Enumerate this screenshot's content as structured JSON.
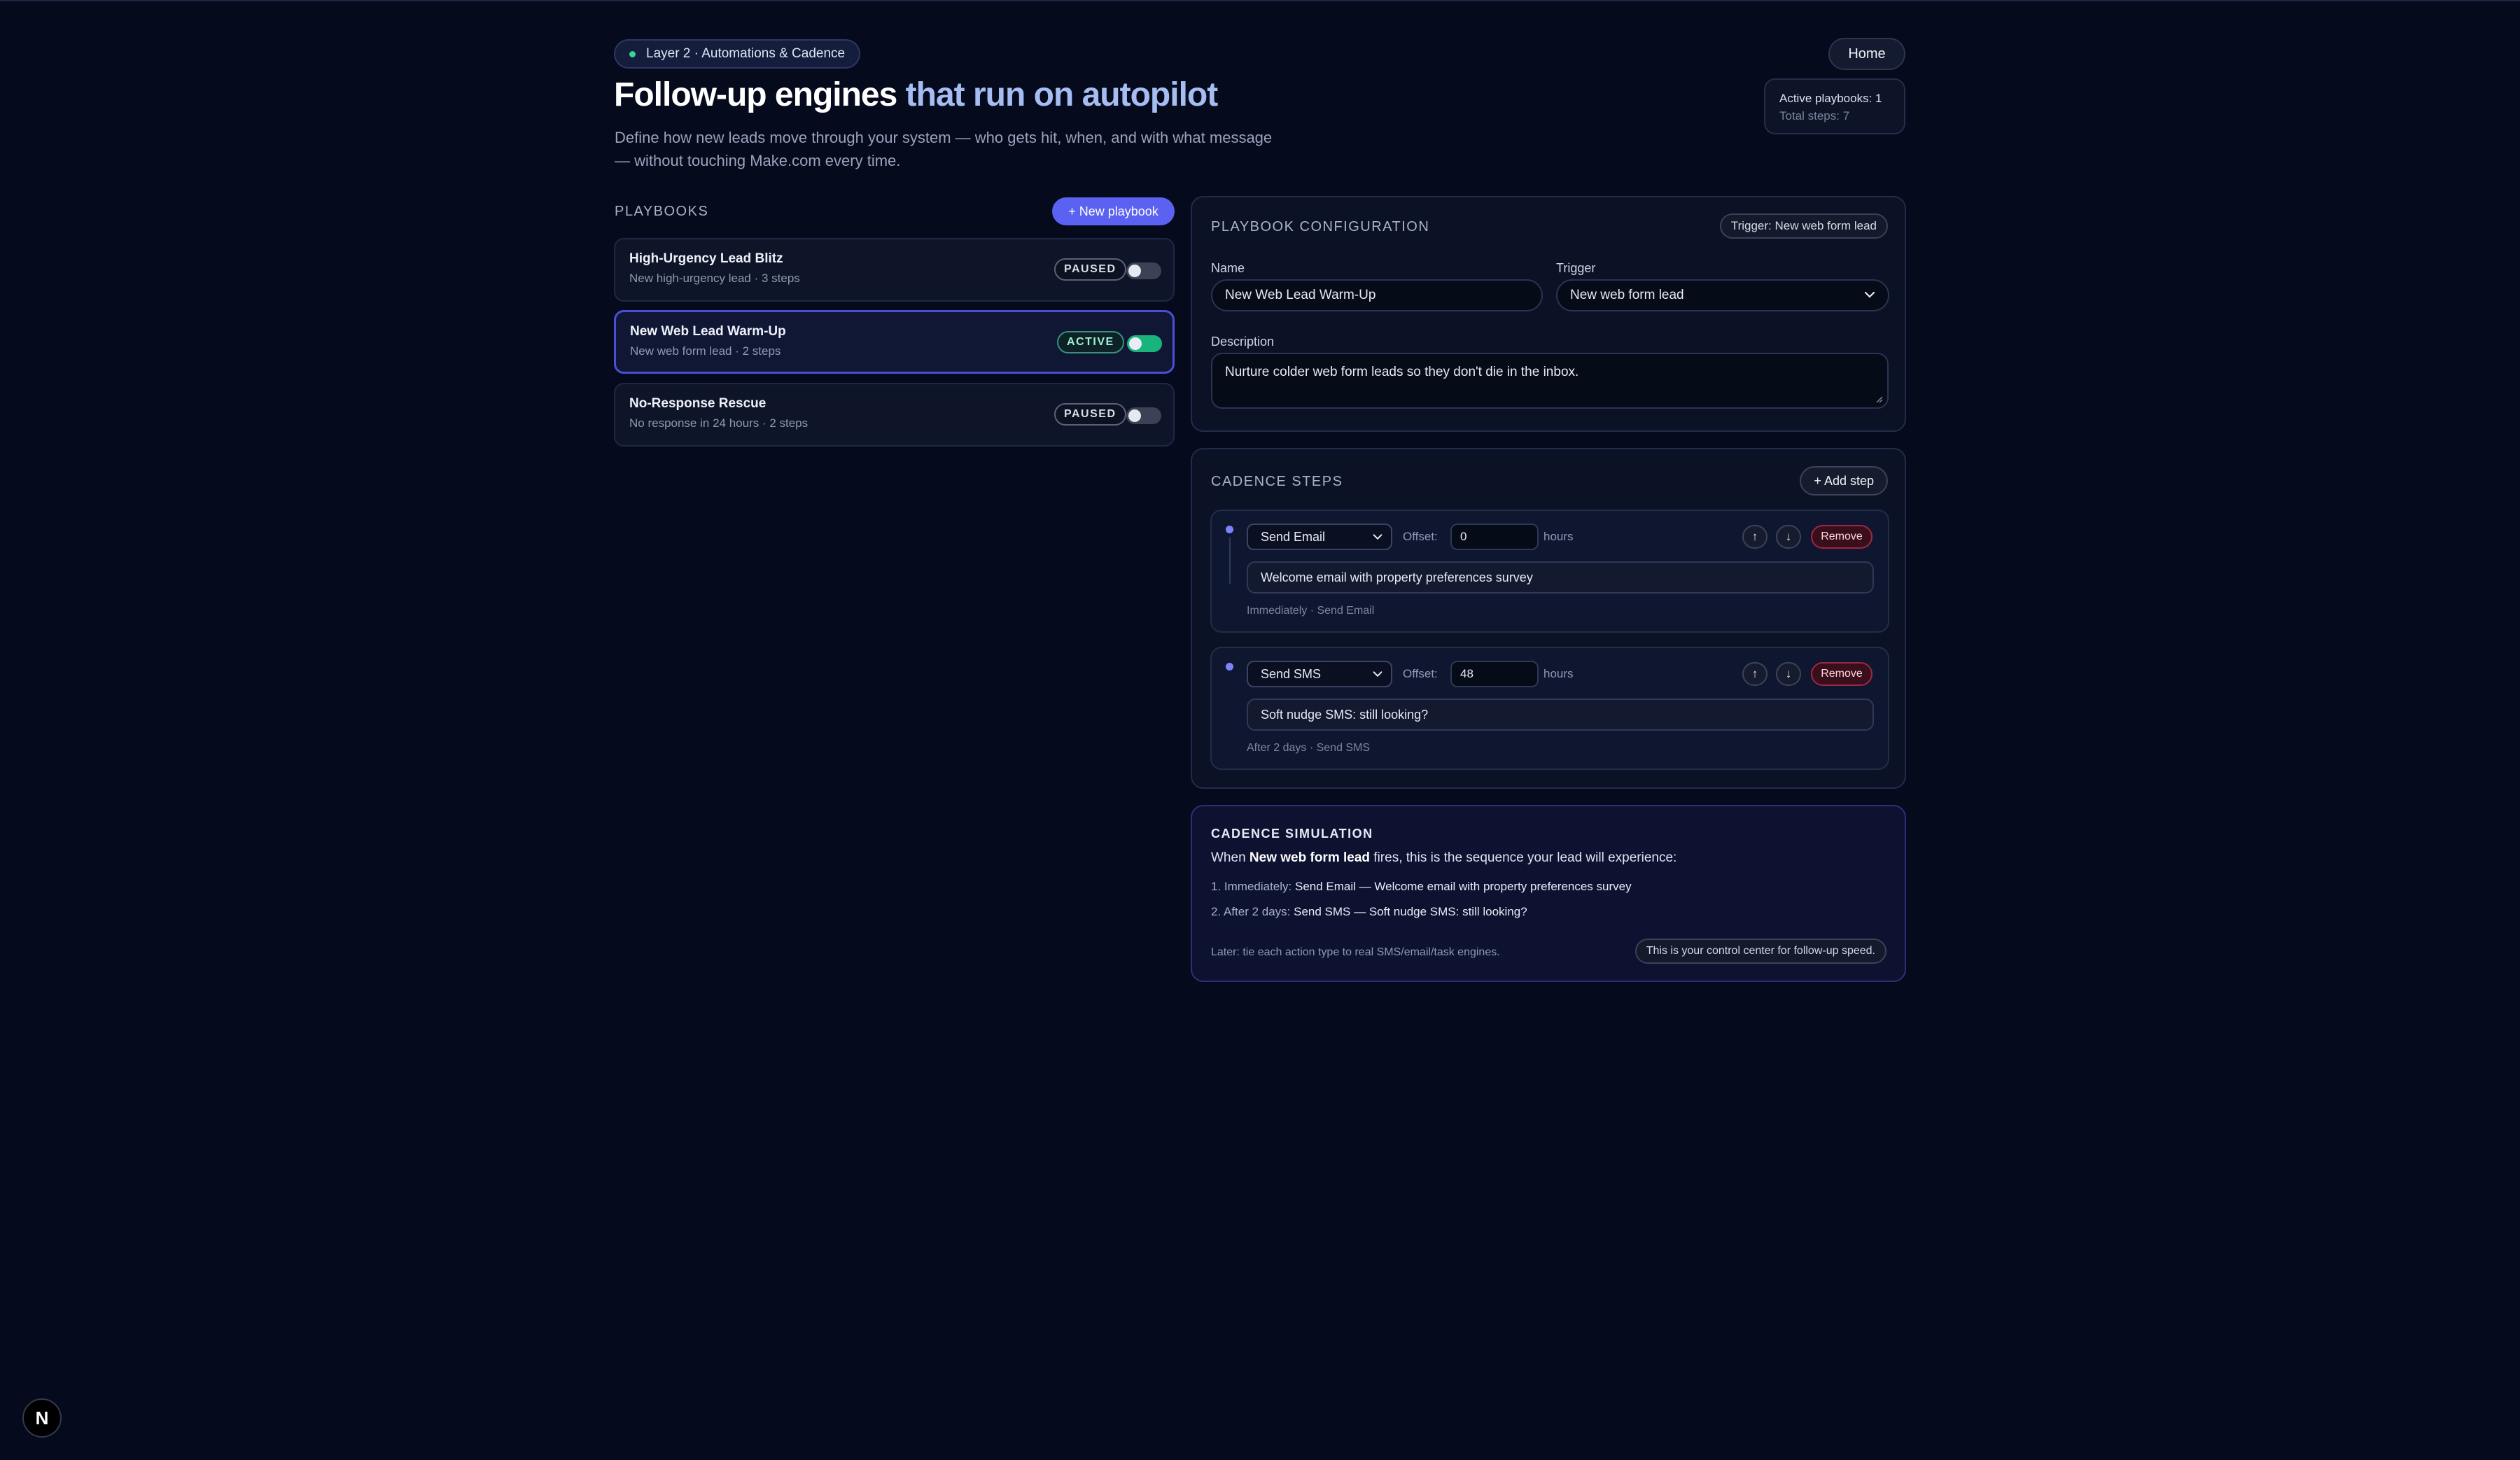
{
  "header": {
    "tag": "Layer 2 · Automations & Cadence",
    "title_main": "Follow-up engines",
    "title_mid": " that ",
    "title_accent": "run on autopilot",
    "subtitle": "Define how new leads move through your system — who gets hit, when, and with what message — without touching Make.com every time.",
    "home_label": "Home",
    "stats": {
      "active": "Active playbooks: 1",
      "total": "Total steps: 7"
    }
  },
  "playbooks": {
    "label": "PLAYBOOKS",
    "new_label": "+ New playbook",
    "items": [
      {
        "name": "High-Urgency Lead Blitz",
        "meta": "New high-urgency lead · 3 steps",
        "status": "PAUSED",
        "enabled": false
      },
      {
        "name": "New Web Lead Warm-Up",
        "meta": "New web form lead · 2 steps",
        "status": "ACTIVE",
        "enabled": true
      },
      {
        "name": "No-Response Rescue",
        "meta": "No response in 24 hours · 2 steps",
        "status": "PAUSED",
        "enabled": false
      }
    ]
  },
  "config": {
    "label": "PLAYBOOK CONFIGURATION",
    "trigger_chip": "Trigger: New web form lead",
    "name_label": "Name",
    "name_value": "New Web Lead Warm-Up",
    "trigger_label": "Trigger",
    "trigger_value": "New web form lead",
    "description_label": "Description",
    "description_value": "Nurture colder web form leads so they don't die in the inbox."
  },
  "steps": {
    "label": "CADENCE STEPS",
    "add_label": "+ Add step",
    "offset_label": "Offset:",
    "hours_label": "hours",
    "remove_label": "Remove",
    "up_label": "↑",
    "down_label": "↓",
    "items": [
      {
        "action": "Send Email",
        "offset": "0",
        "message": "Welcome email with property preferences survey",
        "footer": "Immediately · Send Email"
      },
      {
        "action": "Send SMS",
        "offset": "48",
        "message": "Soft nudge SMS: still looking?",
        "footer": "After 2 days · Send SMS"
      }
    ]
  },
  "simulation": {
    "label": "CADENCE SIMULATION",
    "intro_pre": "When ",
    "intro_trigger": "New web form lead",
    "intro_post": " fires, this is the sequence your lead will experience:",
    "items": [
      {
        "when": "1. Immediately: ",
        "what": "Send Email — Welcome email with property preferences survey"
      },
      {
        "when": "2. After 2 days: ",
        "what": "Send SMS — Soft nudge SMS: still looking?"
      }
    ],
    "note": "Later: tie each action type to real SMS/email/task engines.",
    "chip": "This is your control center for follow-up speed."
  },
  "corner_badge": "N"
}
